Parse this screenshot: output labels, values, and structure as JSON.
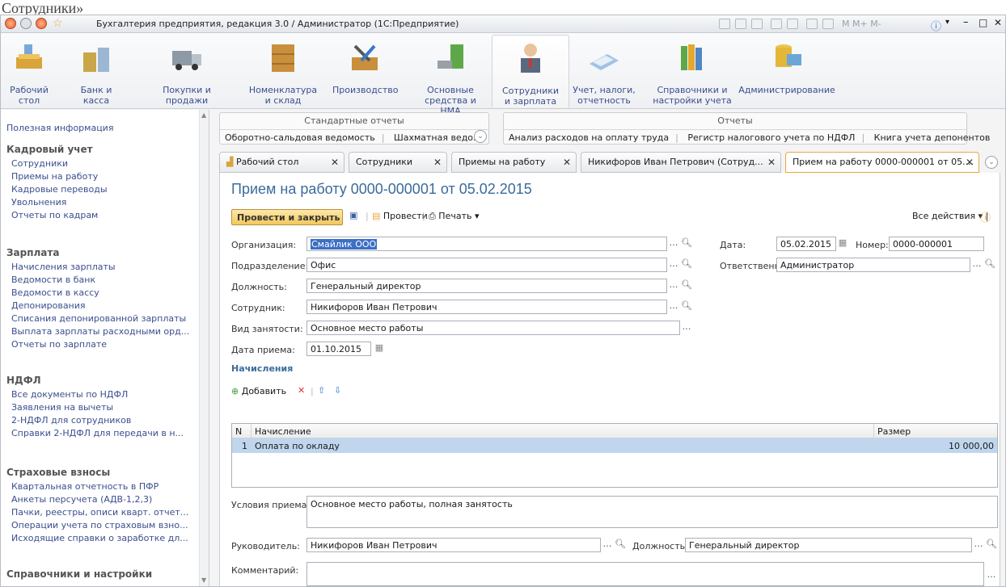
{
  "caption": "Сотрудники»",
  "title_bar": "Бухгалтерия предприятия, редакция 3.0 / Администратор  (1С:Предприятие)",
  "toolbar_right": "M  M+ M-",
  "sections": [
    {
      "label": "Рабочий\nстол",
      "icon": "desktop-icon"
    },
    {
      "label": "Банк и\nкасса",
      "icon": "bank-icon"
    },
    {
      "label": "Покупки и\nпродажи",
      "icon": "truck-icon"
    },
    {
      "label": "Номенклатура\nи склад",
      "icon": "warehouse-icon"
    },
    {
      "label": "Производство",
      "icon": "tools-icon"
    },
    {
      "label": "Основные\nсредства и НМА",
      "icon": "assets-icon"
    },
    {
      "label": "Сотрудники\nи зарплата",
      "icon": "employee-icon"
    },
    {
      "label": "Учет, налоги,\nотчетность",
      "icon": "tax-icon"
    },
    {
      "label": "Справочники и\nнастройки учета",
      "icon": "books-icon"
    },
    {
      "label": "Администрирование",
      "icon": "admin-icon"
    }
  ],
  "left": {
    "info": "Полезная информация",
    "groups": [
      {
        "title": "Кадровый учет",
        "items": [
          "Сотрудники",
          "Приемы на работу",
          "Кадровые переводы",
          "Увольнения",
          "Отчеты по кадрам"
        ]
      },
      {
        "title": "Зарплата",
        "items": [
          "Начисления зарплаты",
          "Ведомости в банк",
          "Ведомости в кассу",
          "Депонирования",
          "Списания депонированной зарплаты",
          "Выплата зарплаты расходными орд...",
          "Отчеты по зарплате"
        ]
      },
      {
        "title": "НДФЛ",
        "items": [
          "Все документы по НДФЛ",
          "Заявления на вычеты",
          "2-НДФЛ для сотрудников",
          "Справки 2-НДФЛ для передачи в н..."
        ]
      },
      {
        "title": "Страховые взносы",
        "items": [
          "Квартальная отчетность в ПФР",
          "Анкеты персучета (АДВ-1,2,3)",
          "Пачки, реестры, описи кварт. отчет...",
          "Операции учета по страховым взно...",
          "Исходящие справки о заработке дл..."
        ]
      },
      {
        "title": "Справочники и настройки",
        "items": []
      }
    ]
  },
  "panels": [
    {
      "title": "Стандартные отчеты",
      "items": [
        "Оборотно-сальдовая ведомость",
        "Шахматная ведо..."
      ]
    },
    {
      "title": "Отчеты",
      "items": [
        "Анализ расходов на оплату труда",
        "Регистр налогового учета по НДФЛ",
        "Книга учета депонентов"
      ]
    }
  ],
  "tabs": [
    "Рабочий стол",
    "Сотрудники",
    "Приемы на работу",
    "Никифоров Иван Петрович (Сотруд...",
    "Прием на работу 0000-000001 от 05...."
  ],
  "form": {
    "title": "Прием на работу 0000-000001 от 05.02.2015",
    "btn_post_close": "Провести и закрыть",
    "btn_post": "Провести",
    "btn_print": "Печать",
    "btn_all": "Все действия",
    "lbl_org": "Организация:",
    "val_org": "Смайлик ООО",
    "lbl_date": "Дата:",
    "val_date": "05.02.2015",
    "lbl_num": "Номер:",
    "val_num": "0000-000001",
    "lbl_dept": "Подразделение:",
    "val_dept": "Офис",
    "lbl_resp": "Ответственный:",
    "val_resp": "Администратор",
    "lbl_pos": "Должность:",
    "val_pos": "Генеральный директор",
    "lbl_emp": "Сотрудник:",
    "val_emp": "Никифоров Иван Петрович",
    "lbl_kind": "Вид занятости:",
    "val_kind": "Основное место работы",
    "lbl_hire": "Дата приема:",
    "val_hire": "01.10.2015",
    "section": "Начисления",
    "btn_add": "Добавить",
    "grid": {
      "col_n": "N",
      "col_name": "Начисление",
      "col_size": "Размер",
      "rows": [
        {
          "n": "1",
          "name": "Оплата по окладу",
          "size": "10 000,00"
        }
      ]
    },
    "lbl_cond": "Условия приема:",
    "val_cond": "Основное место работы, полная занятость",
    "lbl_head": "Руководитель:",
    "val_head": "Никифоров Иван Петрович",
    "lbl_headpos": "Должность:",
    "val_headpos": "Генеральный директор",
    "lbl_comment": "Комментарий:"
  }
}
